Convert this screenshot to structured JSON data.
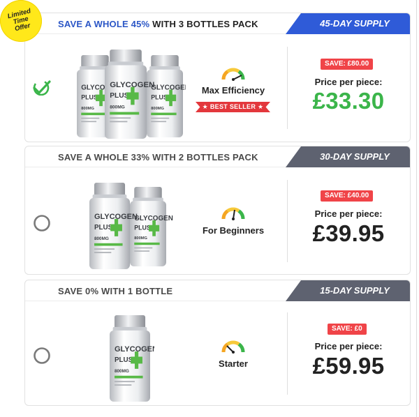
{
  "limited_badge": "Limited Time Offer",
  "options": [
    {
      "headline_prefix": "SAVE A WHOLE 45%",
      "headline_suffix": " WITH 3 BOTTLES PACK",
      "supply": "45-DAY SUPPLY",
      "selected": true,
      "bottles": 3,
      "performance_label": "Max Efficiency",
      "performance_level": 0.9,
      "best_seller": "★ BEST SELLER ★",
      "save_badge": "SAVE: £80.00",
      "price_label": "Price per piece:",
      "price": "£33.30"
    },
    {
      "headline_prefix": "",
      "headline_suffix": "SAVE A WHOLE 33% WITH 2 BOTTLES PACK",
      "supply": "30-DAY SUPPLY",
      "selected": false,
      "bottles": 2,
      "performance_label": "For Beginners",
      "performance_level": 0.55,
      "save_badge": "SAVE: £40.00",
      "price_label": "Price per piece:",
      "price": "£39.95"
    },
    {
      "headline_prefix": "",
      "headline_suffix": "SAVE 0% WITH 1 BOTTLE",
      "supply": "15-DAY SUPPLY",
      "selected": false,
      "bottles": 1,
      "performance_label": "Starter",
      "performance_level": 0.3,
      "save_badge": "SAVE: £0",
      "price_label": "Price per piece:",
      "price": "£59.95"
    }
  ],
  "bottle_label": {
    "brand_line1": "GLYCOGEN",
    "brand_line2": "PLUS",
    "dose": "800MG"
  },
  "colors": {
    "accent_blue": "#2f5bd8",
    "ribbon_gray": "#5e6270",
    "price_green": "#3bb54a",
    "badge_red": "#f04448"
  }
}
